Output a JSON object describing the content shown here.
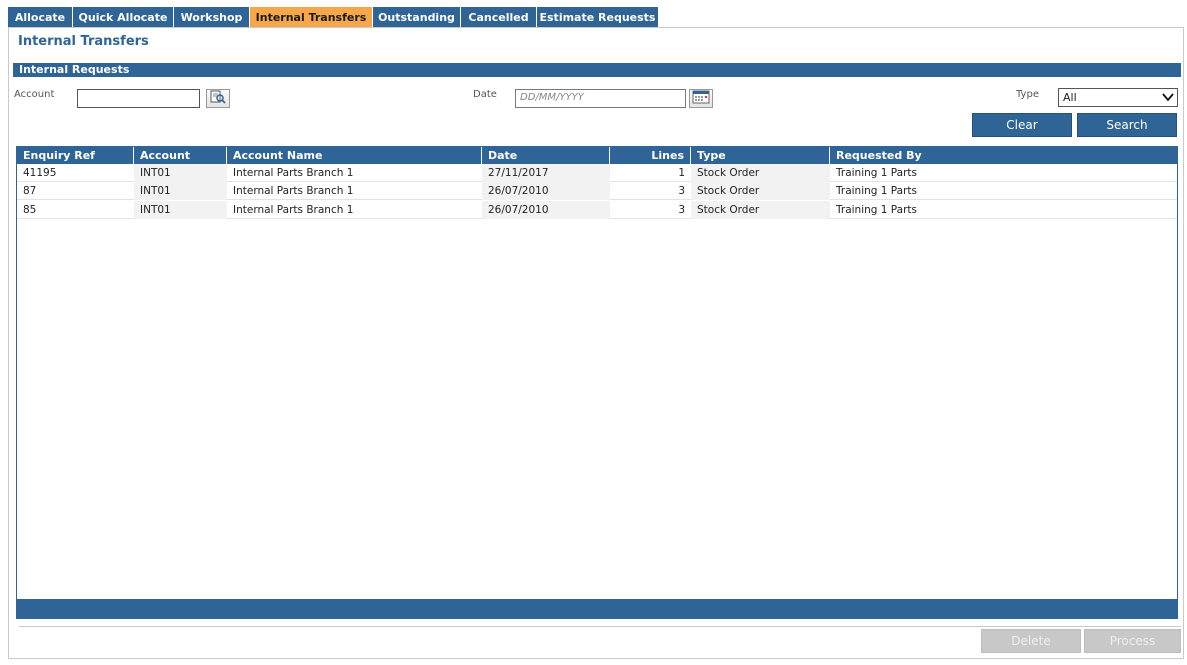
{
  "tabs": [
    {
      "label": "Allocate",
      "active": false
    },
    {
      "label": "Quick Allocate",
      "active": false
    },
    {
      "label": "Workshop",
      "active": false
    },
    {
      "label": "Internal Transfers",
      "active": true
    },
    {
      "label": "Outstanding",
      "active": false
    },
    {
      "label": "Cancelled",
      "active": false
    },
    {
      "label": "Estimate Requests",
      "active": false
    }
  ],
  "page_title": "Internal Transfers",
  "section_title": "Internal Requests",
  "filters": {
    "account_label": "Account",
    "account_value": "",
    "date_label": "Date",
    "date_placeholder": "DD/MM/YYYY",
    "type_label": "Type",
    "type_value": "All",
    "clear_label": "Clear",
    "search_label": "Search"
  },
  "grid": {
    "columns": [
      "Enquiry Ref",
      "Account",
      "Account Name",
      "Date",
      "Lines",
      "Type",
      "Requested By"
    ],
    "rows": [
      {
        "enquiry_ref": "41195",
        "account": "INT01",
        "account_name": "Internal Parts Branch 1",
        "date": "27/11/2017",
        "lines": "1",
        "type": "Stock Order",
        "requested_by": "Training 1 Parts"
      },
      {
        "enquiry_ref": "87",
        "account": "INT01",
        "account_name": "Internal Parts Branch 1",
        "date": "26/07/2010",
        "lines": "3",
        "type": "Stock Order",
        "requested_by": "Training 1 Parts"
      },
      {
        "enquiry_ref": "85",
        "account": "INT01",
        "account_name": "Internal Parts Branch 1",
        "date": "26/07/2010",
        "lines": "3",
        "type": "Stock Order",
        "requested_by": "Training 1 Parts"
      }
    ]
  },
  "actions": {
    "delete_label": "Delete",
    "process_label": "Process"
  },
  "colors": {
    "primary": "#2f6496",
    "active_tab": "#f5a74a",
    "disabled_button": "#c8c8c8"
  },
  "icons": {
    "account_lookup": "search-document-icon",
    "date_picker": "calendar-icon",
    "type_dropdown": "chevron-down-icon"
  }
}
